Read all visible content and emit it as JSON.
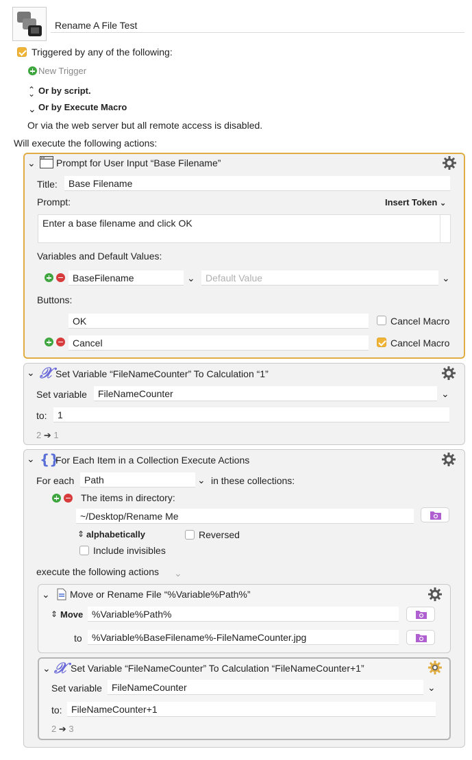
{
  "macro": {
    "name": "Rename A File Test"
  },
  "triggers": {
    "triggered_label": "Triggered by any of the following:",
    "new_trigger": "New Trigger",
    "or_by_script": "Or by script.",
    "or_by_execute": "Or by Execute Macro",
    "web_server_note": "Or via the web server but all remote access is disabled."
  },
  "actions_header": "Will execute the following actions:",
  "prompt_action": {
    "title": "Prompt for User Input “Base Filename”",
    "title_label": "Title:",
    "title_value": "Base Filename",
    "prompt_label": "Prompt:",
    "insert_token": "Insert Token",
    "prompt_text": "Enter a base filename and click OK",
    "variables_label": "Variables and Default Values:",
    "variable_name": "BaseFilename",
    "default_placeholder": "Default Value",
    "buttons_label": "Buttons:",
    "buttons": [
      {
        "label": "OK",
        "cancel_macro_label": "Cancel Macro",
        "cancel_macro_checked": false
      },
      {
        "label": "Cancel",
        "cancel_macro_label": "Cancel Macro",
        "cancel_macro_checked": true
      }
    ]
  },
  "set_var_1": {
    "title": "Set Variable “FileNameCounter” To Calculation “1”",
    "set_label": "Set variable",
    "variable": "FileNameCounter",
    "to_label": "to:",
    "to_value": "1",
    "result_from": "2",
    "result_to": "1"
  },
  "for_each": {
    "title": "For Each Item in a Collection Execute Actions",
    "for_each_label": "For each",
    "variable": "Path",
    "in_collections": "in these collections:",
    "items_in_directory": "The items in directory:",
    "directory": "~/Desktop/Rename Me",
    "sort": "alphabetically",
    "reversed_label": "Reversed",
    "reversed_checked": false,
    "include_invisibles_label": "Include invisibles",
    "include_invisibles_checked": false,
    "execute_label": "execute the following actions"
  },
  "move_action": {
    "title": "Move or Rename File “%Variable%Path%”",
    "mode": "Move",
    "source": "%Variable%Path%",
    "to_label": "to",
    "destination": "%Variable%BaseFilename%-FileNameCounter.jpg"
  },
  "set_var_2": {
    "title": "Set Variable “FileNameCounter” To Calculation “FileNameCounter+1”",
    "set_label": "Set variable",
    "variable": "FileNameCounter",
    "to_label": "to:",
    "to_value": "FileNameCounter+1",
    "result_from": "2",
    "result_to": "3"
  },
  "colors": {
    "selected_border": "#e0ad45",
    "checkbox_on": "#f0b437",
    "plus": "#3fa63f",
    "minus": "#d83b3b",
    "folder": "#b05fd0"
  }
}
